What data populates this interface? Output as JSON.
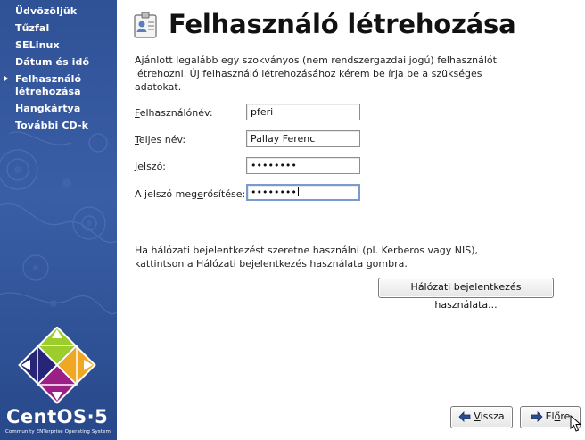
{
  "sidebar": {
    "items": [
      {
        "label_lines": [
          "Üdvözöljük"
        ],
        "current": false
      },
      {
        "label_lines": [
          "Tűzfal"
        ],
        "current": false
      },
      {
        "label_lines": [
          "SELinux"
        ],
        "current": false
      },
      {
        "label_lines": [
          "Dátum és idő"
        ],
        "current": false
      },
      {
        "label_lines": [
          "Felhasználó",
          "létrehozása"
        ],
        "current": true
      },
      {
        "label_lines": [
          "Hangkártya"
        ],
        "current": false
      },
      {
        "label_lines": [
          "További CD-k"
        ],
        "current": false
      }
    ],
    "logo": {
      "name_left": "CentOS",
      "name_sep": "·",
      "name_right": "5",
      "tagline": "Community ENTerprise Operating System"
    }
  },
  "main": {
    "title": "Felhasználó létrehozása",
    "title_icon": "user-id-card-icon",
    "intro": "Ajánlott legalább egy szokványos (nem rendszergazdai jogú) felhasználót létrehozni. Új felhasználó létrehozásához kérem be írja be a szükséges adatokat.",
    "form": {
      "username": {
        "label_pre": "",
        "label_mnemonic": "F",
        "label_post": "elhasználónév:",
        "value": "pferi"
      },
      "fullname": {
        "label_pre": "",
        "label_mnemonic": "T",
        "label_post": "eljes név:",
        "value": "Pallay Ferenc"
      },
      "password": {
        "label_pre": "",
        "label_mnemonic": "J",
        "label_post": "elszó:",
        "value": "••••••••"
      },
      "confirm": {
        "label_pre": "A jelszó meg",
        "label_mnemonic": "e",
        "label_post": "rősítése:",
        "value": "••••••••"
      }
    },
    "network_text": "Ha hálózati bejelentkezést szeretne használni (pl. Kerberos vagy NIS), kattintson a Hálózati bejelentkezés használata gombra.",
    "network_button": "Hálózati bejelentkezés használata..."
  },
  "footer": {
    "back": {
      "pre": "",
      "mnemonic": "V",
      "post": "issza",
      "icon": "arrow-left-icon"
    },
    "next": {
      "pre": "El",
      "mnemonic": "ő",
      "post": "re",
      "icon": "arrow-right-icon"
    }
  },
  "colors": {
    "sidebar_bg": "#2f5196",
    "focus_border": "#7a9bd0",
    "arrow_icon": "#2a4d8f"
  }
}
